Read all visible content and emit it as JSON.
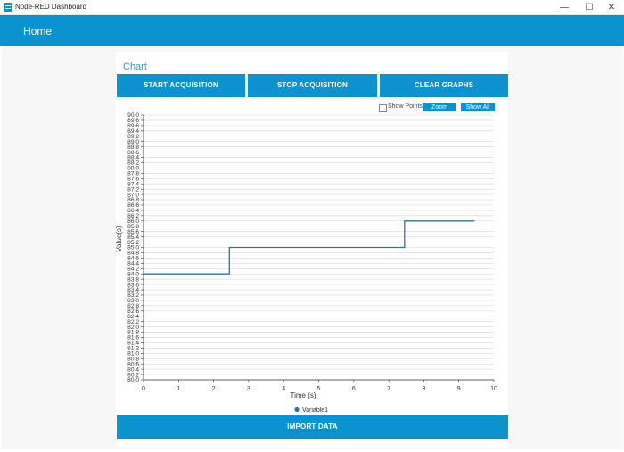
{
  "window": {
    "title": "Node-RED Dashboard",
    "minimize": "—",
    "maximize": "☐",
    "close": "✕"
  },
  "header": {
    "title": "Home"
  },
  "card": {
    "title": "Chart"
  },
  "buttons": {
    "start": "START ACQUISITION",
    "stop": "STOP ACQUISITION",
    "clear": "CLEAR GRAPHS",
    "import": "IMPORT DATA"
  },
  "chart_controls": {
    "show_points": "Show Points",
    "zoom": "Zoom",
    "show_all": "Show All"
  },
  "colors": {
    "accent": "#0c93cf",
    "series": "#1f77b4"
  },
  "chart_data": {
    "type": "line",
    "xlabel": "Time (s)",
    "ylabel": "Value(s)",
    "xlim": [
      0,
      10
    ],
    "ylim": [
      80.0,
      90.0
    ],
    "xticks": [
      "0",
      "1",
      "2",
      "3",
      "4",
      "5",
      "6",
      "7",
      "8",
      "9",
      "10"
    ],
    "yticks": [
      "80.0",
      "80.2",
      "80.4",
      "80.6",
      "80.8",
      "81.0",
      "81.2",
      "81.4",
      "81.6",
      "81.8",
      "82.0",
      "82.2",
      "82.4",
      "82.6",
      "82.8",
      "83.0",
      "83.2",
      "83.4",
      "83.6",
      "83.8",
      "84.0",
      "84.2",
      "84.4",
      "84.6",
      "84.8",
      "85.0",
      "85.2",
      "85.4",
      "85.6",
      "85.8",
      "86.0",
      "86.2",
      "86.4",
      "86.6",
      "86.8",
      "87.0",
      "87.2",
      "87.4",
      "87.6",
      "87.8",
      "88.0",
      "88.2",
      "88.4",
      "88.6",
      "88.8",
      "89.0",
      "89.2",
      "89.4",
      "89.6",
      "89.8",
      "90.0"
    ],
    "grid": true,
    "legend_position": "bottom-center",
    "step": true,
    "series": [
      {
        "name": "Variable1",
        "x": [
          0,
          2.45,
          2.45,
          7.45,
          7.45,
          9.45
        ],
        "y": [
          84.0,
          84.0,
          85.0,
          85.0,
          86.0,
          86.0
        ]
      }
    ]
  }
}
